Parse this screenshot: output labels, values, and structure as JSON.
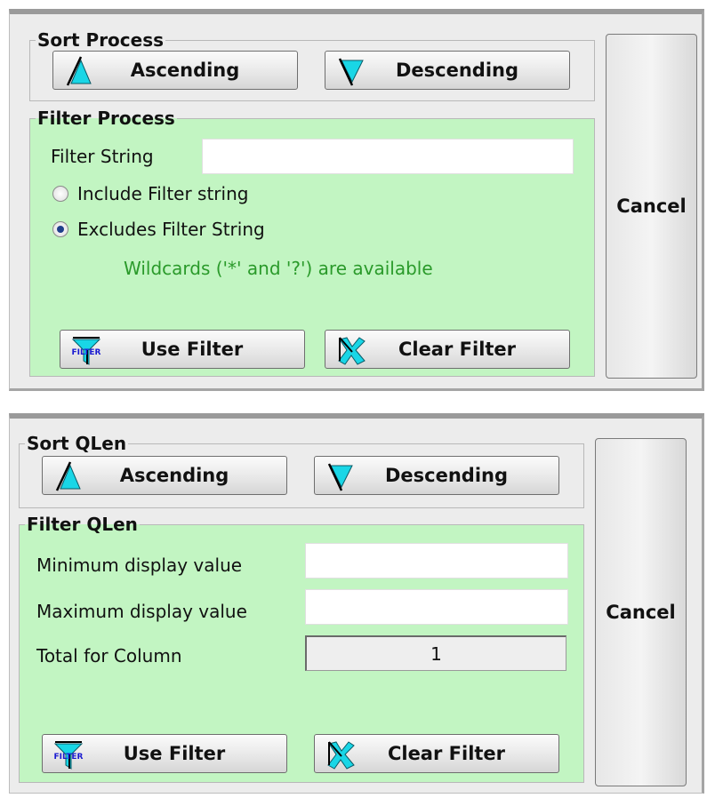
{
  "process": {
    "sort_title": "Sort Process",
    "ascending": "Ascending",
    "descending": "Descending",
    "filter_title": "Filter Process",
    "filter_string_label": "Filter String",
    "filter_string_value": "",
    "include_label": "Include Filter string",
    "exclude_label": "Excludes Filter String",
    "selected_mode": "exclude",
    "hint": "Wildcards ('*' and '?') are available",
    "use_filter": "Use Filter",
    "clear_filter": "Clear Filter",
    "cancel": "Cancel"
  },
  "qlen": {
    "sort_title": "Sort QLen",
    "ascending": "Ascending",
    "descending": "Descending",
    "filter_title": "Filter QLen",
    "min_label": "Minimum display value",
    "min_value": "",
    "max_label": "Maximum display value",
    "max_value": "",
    "total_label": "Total for Column",
    "total_value": "1",
    "use_filter": "Use Filter",
    "clear_filter": "Clear Filter",
    "cancel": "Cancel"
  },
  "icons": {
    "filter_icon_text": "FILTER"
  },
  "colors": {
    "group_green": "#c2f5c2",
    "hint_green": "#2a9a2a",
    "icon_cyan": "#19d6e6",
    "radio_selected": "#1f3f8a"
  }
}
